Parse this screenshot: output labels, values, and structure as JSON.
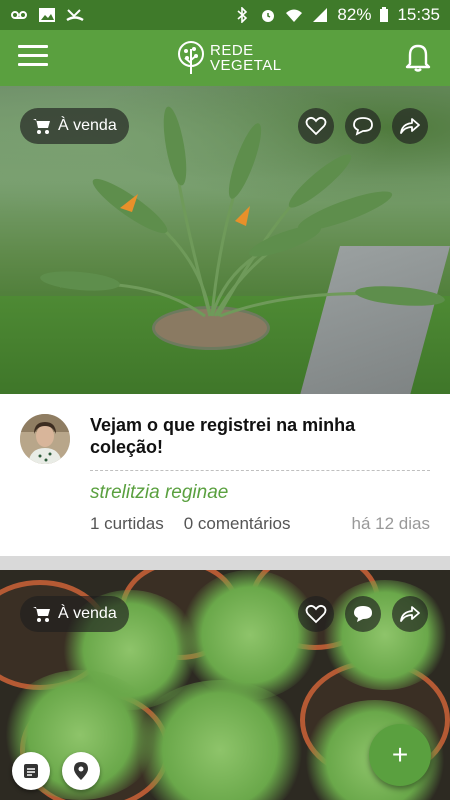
{
  "status_bar": {
    "battery": "82%",
    "time": "15:35",
    "icons": [
      "voicemail-icon",
      "image-icon",
      "missed-call-icon",
      "bluetooth-icon",
      "alarm-icon",
      "wifi-icon",
      "signal-icon",
      "battery-icon"
    ]
  },
  "app_bar": {
    "logo_line1": "REDE",
    "logo_line2": "VEGETAL",
    "icons": [
      "menu-icon",
      "tree-logo-icon",
      "bell-icon"
    ]
  },
  "feed": {
    "posts": [
      {
        "sale_label": "À venda",
        "title": "Vejam o que registrei na minha coleção!",
        "species": "strelitzia reginae",
        "likes": "1 curtidas",
        "comments": "0 comentários",
        "time": "há 12 dias"
      },
      {
        "sale_label": "À venda"
      }
    ]
  },
  "colors": {
    "status_bar": "#3f7a2a",
    "app_bar": "#5aa03f",
    "accent": "#5aa03f"
  },
  "fab": {
    "label": "+"
  }
}
